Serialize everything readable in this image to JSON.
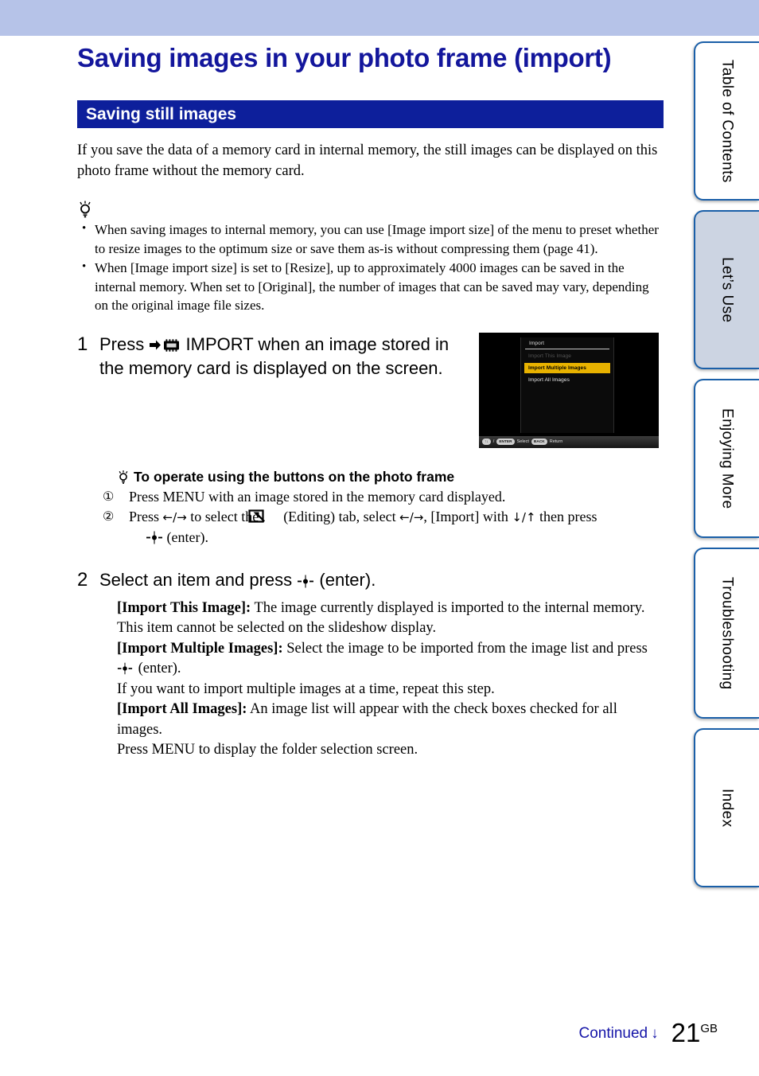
{
  "banner": {
    "color": "#b6c3e8"
  },
  "page": {
    "title": "Saving images in your photo frame (import)",
    "section_heading": "Saving still images",
    "intro": "If you save the data of a memory card in internal memory, the still images can be displayed on this photo frame without the memory card."
  },
  "tips": {
    "bullets": [
      "When saving images to internal memory, you can use [Image import size] of the menu to preset whether to resize images to the optimum size or save them as-is without compressing them (page 41).",
      "When [Image import size] is set to [Resize], up to approximately 4000 images can be saved in the internal memory. When set to [Original], the number of images that can be saved may vary, depending on the original image file sizes."
    ]
  },
  "steps": [
    {
      "number": "1",
      "text_before_icon": "Press",
      "text_after_icon": "IMPORT when an image stored in the memory card is displayed on the screen."
    },
    {
      "number": "2",
      "head_before_icon": "Select an item and press",
      "head_after_icon": "(enter).",
      "details": [
        {
          "label": "[Import This Image]:",
          "text": " The image currently displayed is imported to the internal memory."
        },
        {
          "label": "",
          "text": "This item cannot be selected on the slideshow display."
        },
        {
          "label": "[Import Multiple Images]:",
          "text": " Select the image to be imported from the image list and press"
        },
        {
          "label": "",
          "text": "(enter)."
        },
        {
          "label": "",
          "text": "If you want to import multiple images at a time, repeat this step."
        },
        {
          "label": "[Import All Images]:",
          "text": " An image list will appear with the check boxes checked for all images."
        },
        {
          "label": "",
          "text": "Press MENU to display the folder selection screen."
        }
      ]
    }
  ],
  "device_screen": {
    "menu_title": "Import",
    "items": [
      {
        "label": "Import This Image",
        "state": "disabled"
      },
      {
        "label": "Import Multiple Images",
        "state": "selected"
      },
      {
        "label": "Import All Images",
        "state": "normal"
      }
    ],
    "status": {
      "dpad": "↑↓",
      "slash": "/",
      "enter_key": "ENTER",
      "select_label": "Select",
      "back_key": "BACK",
      "return_label": "Return"
    },
    "highlight_color": "#e8b200"
  },
  "inset_tip": {
    "heading": "To operate using the buttons on the photo frame",
    "line1_num": "①",
    "line1": "Press MENU with an image stored in the memory card displayed.",
    "line2_num": "②",
    "line2_a": "Press",
    "line2_arrows1": "←/→",
    "line2_b": "to select the",
    "line2_c": "(Editing) tab, select",
    "line2_arrows2": "←/→",
    "line2_d": ", [Import] with",
    "line2_arrows3": "↓/↑",
    "line2_e": "then press",
    "line3": "(enter)."
  },
  "tabs": [
    {
      "label": "Table of Contents",
      "active": false
    },
    {
      "label": "Let’s Use",
      "active": true
    },
    {
      "label": "Enjoying More",
      "active": false
    },
    {
      "label": "Troubleshooting",
      "active": false
    },
    {
      "label": "Index",
      "active": false
    }
  ],
  "footer": {
    "continued": "Continued",
    "continued_arrow": "↓",
    "page_number": "21",
    "page_suffix": "GB",
    "link_color": "#1515a8"
  }
}
